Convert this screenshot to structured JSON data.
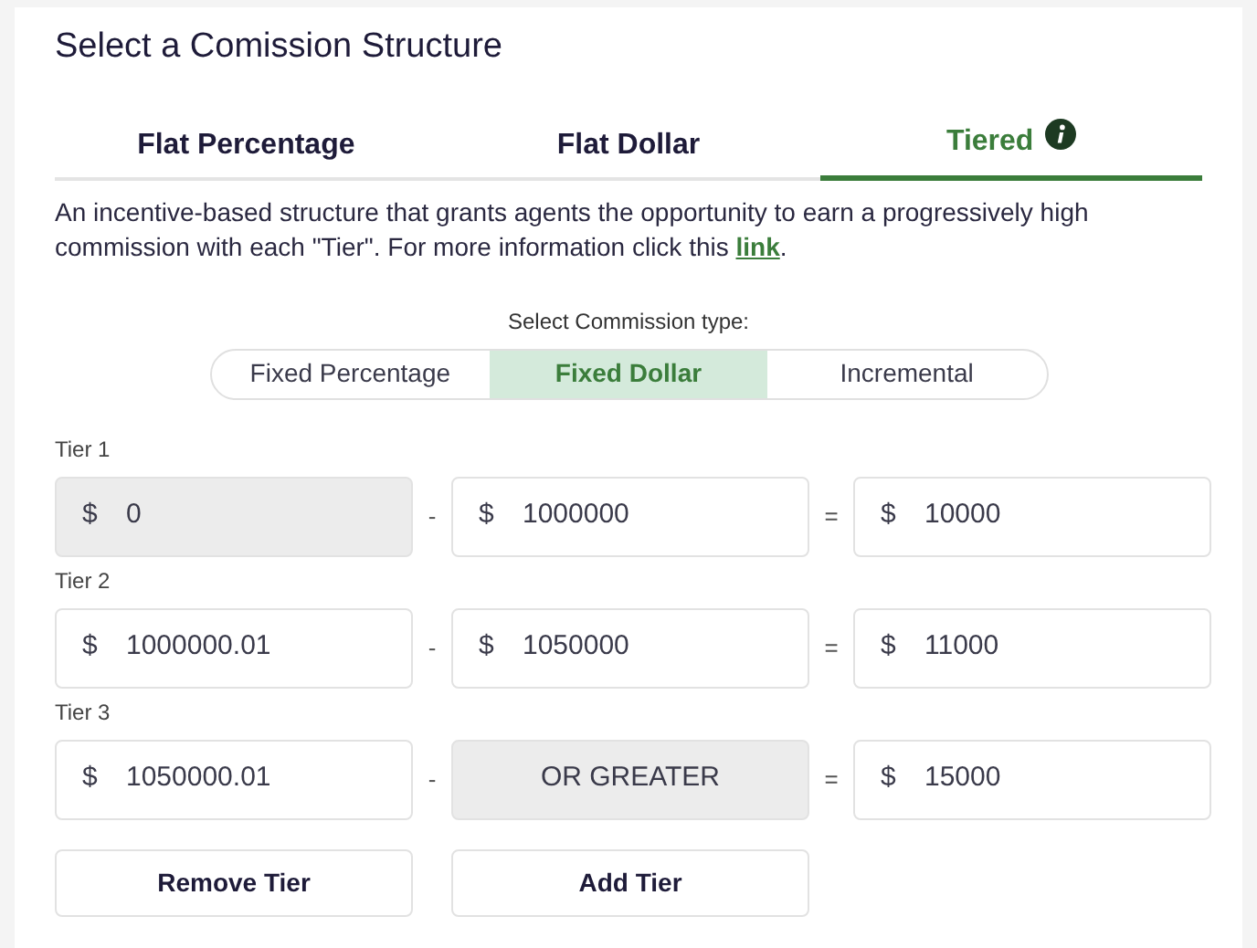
{
  "title": "Select a Comission Structure",
  "tabs": [
    {
      "label": "Flat Percentage",
      "selected": false,
      "info": false
    },
    {
      "label": "Flat Dollar",
      "selected": false,
      "info": false
    },
    {
      "label": "Tiered",
      "selected": true,
      "info": true
    }
  ],
  "description": {
    "text": "An incentive-based structure that grants agents the opportunity to earn a progressively high commission with each \"Tier\". For more information click this ",
    "link": "link",
    "end": "."
  },
  "type_label": "Select Commission type:",
  "types": [
    {
      "label": "Fixed Percentage",
      "selected": false
    },
    {
      "label": "Fixed Dollar",
      "selected": true
    },
    {
      "label": "Incremental",
      "selected": false
    }
  ],
  "tiers": [
    {
      "label": "Tier 1",
      "from": {
        "currency": "$",
        "value": "0",
        "disabled": true
      },
      "dash": "-",
      "to": {
        "currency": "$",
        "value": "1000000",
        "disabled": false
      },
      "equals": "=",
      "payout": {
        "currency": "$",
        "value": "10000",
        "disabled": false
      }
    },
    {
      "label": "Tier 2",
      "from": {
        "currency": "$",
        "value": "1000000.01",
        "disabled": false
      },
      "dash": "-",
      "to": {
        "currency": "$",
        "value": "1050000",
        "disabled": false
      },
      "equals": "=",
      "payout": {
        "currency": "$",
        "value": "11000",
        "disabled": false
      }
    },
    {
      "label": "Tier 3",
      "from": {
        "currency": "$",
        "value": "1050000.01",
        "disabled": false
      },
      "dash": "-",
      "to": {
        "value": "OR GREATER",
        "disabled": true
      },
      "equals": "=",
      "payout": {
        "currency": "$",
        "value": "15000",
        "disabled": false
      }
    }
  ],
  "buttons": [
    "Remove Tier",
    "Add Tier"
  ]
}
